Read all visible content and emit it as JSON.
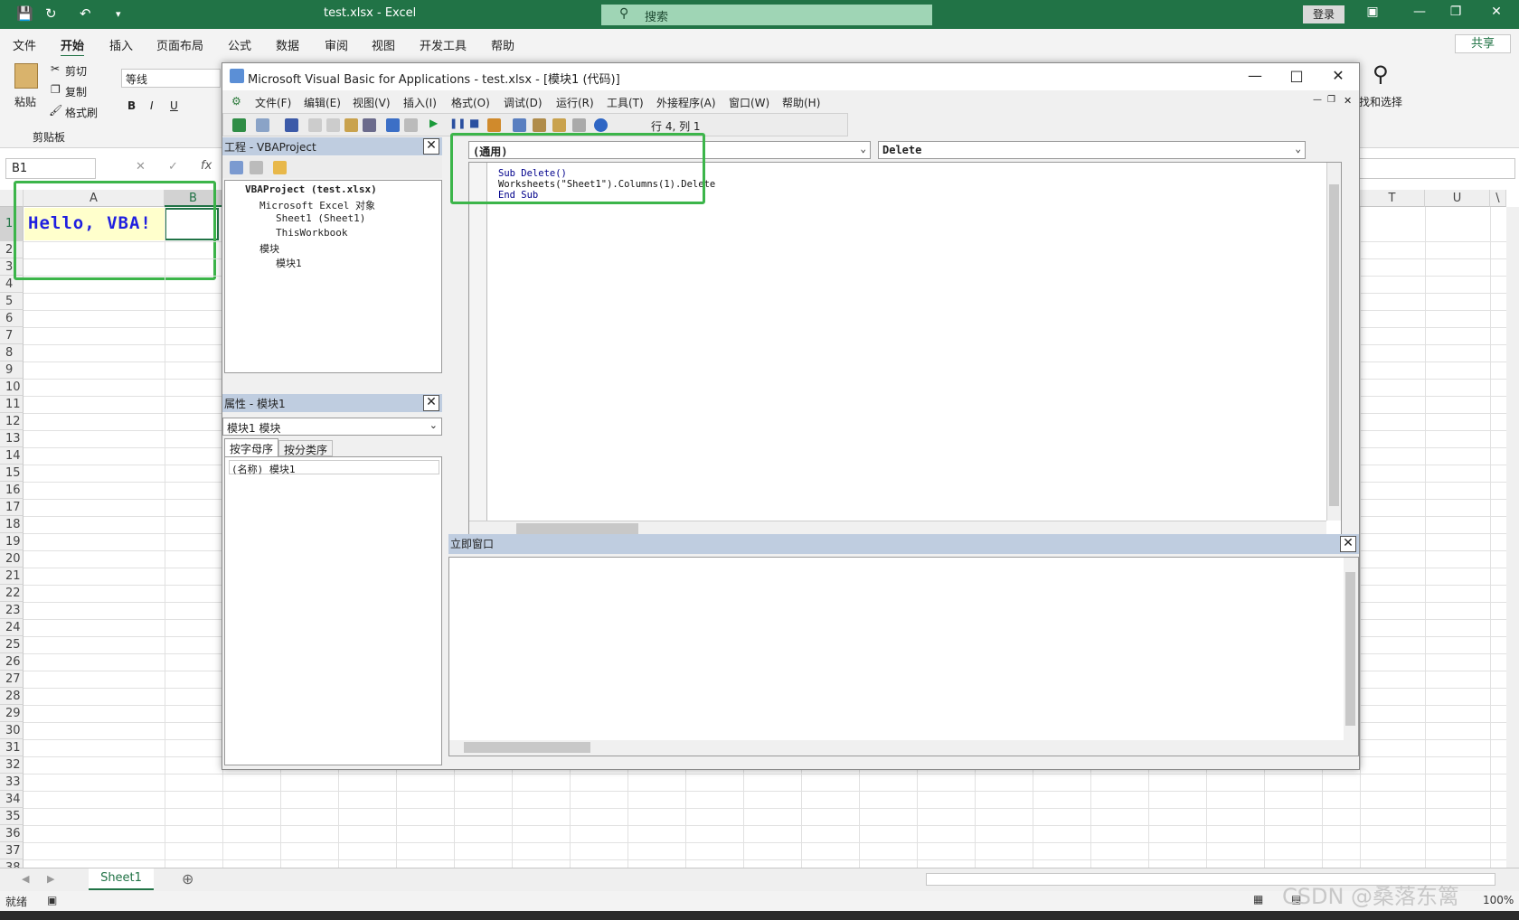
{
  "excel": {
    "window_title": "test.xlsx  -  Excel",
    "search_placeholder": "搜索",
    "login_label": "登录",
    "ribbon_tabs": [
      "文件",
      "开始",
      "插入",
      "页面布局",
      "公式",
      "数据",
      "审阅",
      "视图",
      "开发工具",
      "帮助"
    ],
    "share_label": "共享",
    "clipboard": {
      "paste": "粘贴",
      "cut": "剪切",
      "copy": "复制",
      "format_painter": "格式刷",
      "group_label": "剪贴板"
    },
    "font_name": "等线",
    "find_select": "找和选择",
    "namebox": "B1",
    "fx": "fx",
    "columns_left": [
      "A",
      "B"
    ],
    "columns_right": [
      "T",
      "U",
      "\\"
    ],
    "rows": [
      "1",
      "2",
      "3",
      "4",
      "5",
      "6",
      "7",
      "8",
      "9",
      "10",
      "11",
      "12",
      "13",
      "14",
      "15",
      "16",
      "17",
      "18",
      "19",
      "20",
      "21",
      "22",
      "23",
      "24",
      "25",
      "26",
      "27",
      "28",
      "29",
      "30",
      "31",
      "32",
      "33",
      "34",
      "35",
      "36",
      "37",
      "38"
    ],
    "cell_a1": "Hello, VBA!",
    "sheet_tab": "Sheet1",
    "status": "就绪",
    "zoom": "100%",
    "watermark": "CSDN @桑落东篱"
  },
  "vbe": {
    "title": "Microsoft Visual Basic for Applications - test.xlsx - [模块1 (代码)]",
    "menu": [
      "文件(F)",
      "编辑(E)",
      "视图(V)",
      "插入(I)",
      "格式(O)",
      "调试(D)",
      "运行(R)",
      "工具(T)",
      "外接程序(A)",
      "窗口(W)",
      "帮助(H)"
    ],
    "cursor_pos": "行 4, 列 1",
    "project_title": "工程 - VBAProject",
    "tree": {
      "root": "VBAProject (test.xlsx)",
      "excel_objects": "Microsoft Excel 对象",
      "sheet1": "Sheet1 (Sheet1)",
      "thisworkbook": "ThisWorkbook",
      "modules": "模块",
      "module1": "模块1"
    },
    "props_title": "属性 - 模块1",
    "props_object": "模块1 模块",
    "props_tab_alpha": "按字母序",
    "props_tab_cat": "按分类序",
    "props_row": "(名称) 模块1",
    "combo_object": "(通用)",
    "combo_proc": "Delete",
    "code": {
      "line1": "Sub Delete()",
      "line2": "Worksheets(\"Sheet1\").Columns(1).Delete",
      "line3": "End Sub"
    },
    "immediate_title": "立即窗口"
  }
}
